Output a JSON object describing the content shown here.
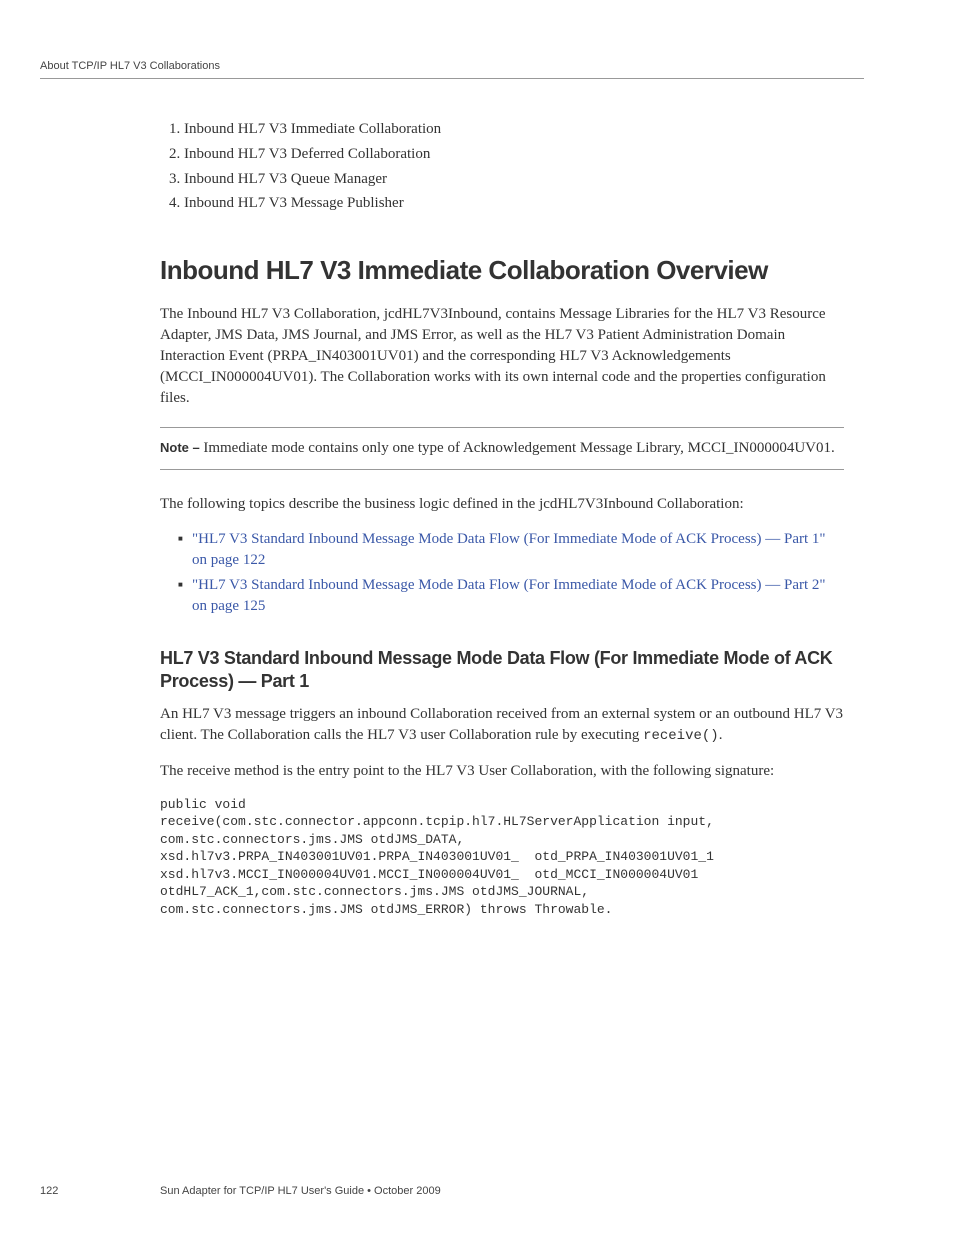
{
  "header": {
    "running": "About TCP/IP HL7 V3 Collaborations"
  },
  "list_items": [
    "Inbound HL7 V3 Immediate Collaboration",
    "Inbound HL7 V3 Deferred Collaboration",
    "Inbound HL7 V3 Queue Manager",
    "Inbound HL7 V3 Message Publisher"
  ],
  "section": {
    "title": "Inbound HL7 V3 Immediate Collaboration Overview",
    "intro": "The Inbound HL7 V3 Collaboration, jcdHL7V3Inbound, contains Message Libraries for the HL7 V3 Resource Adapter, JMS Data, JMS Journal, and JMS Error, as well as the HL7 V3 Patient Administration Domain Interaction Event (PRPA_IN403001UV01) and the corresponding HL7 V3 Acknowledgements (MCCI_IN000004UV01). The Collaboration works with its own internal code and the properties configuration files."
  },
  "note": {
    "label": "Note – ",
    "text": "Immediate mode contains only one type of Acknowledgement Message Library, MCCI_IN000004UV01."
  },
  "followup": "The following topics describe the business logic defined in the jcdHL7V3Inbound Collaboration:",
  "links": [
    "\"HL7 V3 Standard Inbound Message Mode Data Flow (For Immediate Mode of ACK Process) — Part 1\" on page 122",
    "\"HL7 V3 Standard Inbound Message Mode Data Flow (For Immediate Mode of ACK Process) — Part 2\" on page 125"
  ],
  "subsection": {
    "title": "HL7 V3 Standard Inbound Message Mode Data Flow (For Immediate Mode of ACK Process) — Part 1",
    "para1_a": "An HL7 V3 message triggers an inbound Collaboration received from an external system or an outbound HL7 V3 client. The Collaboration calls the HL7 V3 user Collaboration rule by executing ",
    "para1_code": "receive()",
    "para1_b": ".",
    "para2": "The receive method is the entry point to the HL7 V3 User Collaboration, with the following signature:",
    "code": "public void\nreceive(com.stc.connector.appconn.tcpip.hl7.HL7ServerApplication input,\ncom.stc.connectors.jms.JMS otdJMS_DATA,\nxsd.hl7v3.PRPA_IN403001UV01.PRPA_IN403001UV01_  otd_PRPA_IN403001UV01_1\nxsd.hl7v3.MCCI_IN000004UV01.MCCI_IN000004UV01_  otd_MCCI_IN000004UV01\notdHL7_ACK_1,com.stc.connectors.jms.JMS otdJMS_JOURNAL,\ncom.stc.connectors.jms.JMS otdJMS_ERROR) throws Throwable."
  },
  "footer": {
    "page": "122",
    "doc": "Sun Adapter for TCP/IP HL7 User's Guide  •  October 2009"
  }
}
